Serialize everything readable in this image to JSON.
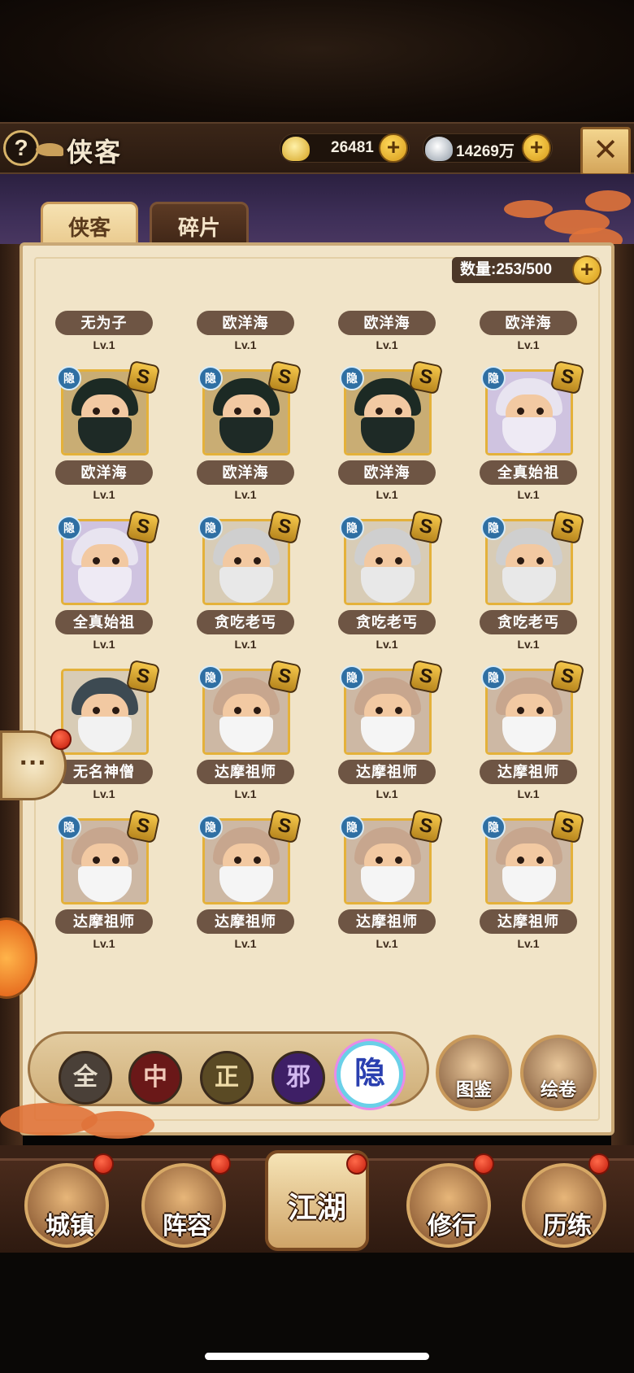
{
  "header": {
    "title": "侠客",
    "help_symbol": "?",
    "gold": "26481",
    "silver": "14269万",
    "plus_symbol": "+",
    "close_symbol": "✕"
  },
  "tabs": [
    {
      "label": "侠客",
      "active": true
    },
    {
      "label": "碎片",
      "active": false
    }
  ],
  "count": {
    "label": "数量:253/500"
  },
  "heroes": [
    {
      "name": "无为子",
      "level": "Lv.1",
      "type": "white",
      "hidden": "",
      "rank": ""
    },
    {
      "name": "欧洋海",
      "level": "Lv.1",
      "type": "dark",
      "hidden": "",
      "rank": ""
    },
    {
      "name": "欧洋海",
      "level": "Lv.1",
      "type": "dark",
      "hidden": "",
      "rank": ""
    },
    {
      "name": "欧洋海",
      "level": "Lv.1",
      "type": "dark",
      "hidden": "",
      "rank": ""
    },
    {
      "name": "欧洋海",
      "level": "Lv.1",
      "type": "dark",
      "hidden": "隐",
      "rank": "S"
    },
    {
      "name": "欧洋海",
      "level": "Lv.1",
      "type": "dark",
      "hidden": "隐",
      "rank": "S"
    },
    {
      "name": "欧洋海",
      "level": "Lv.1",
      "type": "dark",
      "hidden": "隐",
      "rank": "S"
    },
    {
      "name": "全真始祖",
      "level": "Lv.1",
      "type": "purple",
      "hidden": "隐",
      "rank": "S"
    },
    {
      "name": "全真始祖",
      "level": "Lv.1",
      "type": "purple",
      "hidden": "隐",
      "rank": "S"
    },
    {
      "name": "贪吃老丐",
      "level": "Lv.1",
      "type": "grey",
      "hidden": "隐",
      "rank": "S"
    },
    {
      "name": "贪吃老丐",
      "level": "Lv.1",
      "type": "grey",
      "hidden": "隐",
      "rank": "S"
    },
    {
      "name": "贪吃老丐",
      "level": "Lv.1",
      "type": "grey",
      "hidden": "隐",
      "rank": "S"
    },
    {
      "name": "无名神僧",
      "level": "Lv.1",
      "type": "monk",
      "hidden": "",
      "rank": "S"
    },
    {
      "name": "达摩祖师",
      "level": "Lv.1",
      "type": "bald",
      "hidden": "隐",
      "rank": "S"
    },
    {
      "name": "达摩祖师",
      "level": "Lv.1",
      "type": "bald",
      "hidden": "隐",
      "rank": "S"
    },
    {
      "name": "达摩祖师",
      "level": "Lv.1",
      "type": "bald",
      "hidden": "隐",
      "rank": "S"
    },
    {
      "name": "达摩祖师",
      "level": "Lv.1",
      "type": "bald",
      "hidden": "隐",
      "rank": "S"
    },
    {
      "name": "达摩祖师",
      "level": "Lv.1",
      "type": "bald",
      "hidden": "隐",
      "rank": "S"
    },
    {
      "name": "达摩祖师",
      "level": "Lv.1",
      "type": "bald",
      "hidden": "隐",
      "rank": "S"
    },
    {
      "name": "达摩祖师",
      "level": "Lv.1",
      "type": "bald",
      "hidden": "隐",
      "rank": "S"
    }
  ],
  "filters": {
    "all": "全",
    "middle": "中",
    "righteous": "正",
    "evil": "邪",
    "hidden": "隐",
    "active": "隐"
  },
  "side_buttons": {
    "atlas": "图鉴",
    "scroll": "绘卷",
    "chat_symbol": "···"
  },
  "nav": {
    "town": "城镇",
    "lineup": "阵容",
    "jianghu": "江湖",
    "cultivate": "修行",
    "trial": "历练"
  },
  "colors": {
    "gold_accent": "#e4b13a",
    "panel_bg": "#f1e4c8",
    "name_plate": "#6e5544",
    "hidden_badge": "#2f6fa3",
    "red_dot": "#d6261a"
  }
}
